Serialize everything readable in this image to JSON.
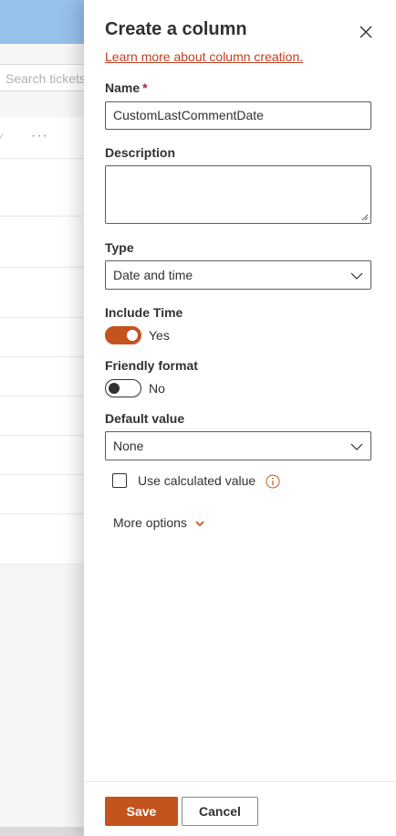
{
  "background": {
    "search_placeholder": "Search tickets"
  },
  "panel": {
    "title": "Create a column",
    "learn_link": "Learn more about column creation.",
    "name": {
      "label": "Name",
      "required_mark": "*",
      "value": "CustomLastCommentDate"
    },
    "description": {
      "label": "Description",
      "value": ""
    },
    "type": {
      "label": "Type",
      "value": "Date and time"
    },
    "include_time": {
      "label": "Include Time",
      "state": "Yes",
      "on": true
    },
    "friendly_format": {
      "label": "Friendly format",
      "state": "No",
      "on": false
    },
    "default_value": {
      "label": "Default value",
      "value": "None"
    },
    "use_calculated": {
      "label": "Use calculated value",
      "checked": false
    },
    "more_options": "More options",
    "save_label": "Save",
    "cancel_label": "Cancel"
  },
  "colors": {
    "accent": "#c4541d",
    "link": "#c43e1c",
    "header_blue": "#5fa0e0"
  }
}
